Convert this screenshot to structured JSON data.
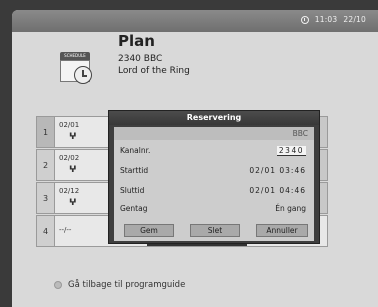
{
  "header": {
    "time": "11:03",
    "date": "22/10"
  },
  "schedule_icon": {
    "label": "SCHEDULE"
  },
  "plan": {
    "title": "Plan",
    "channel": "2340  BBC",
    "program": "Lord of the Ring"
  },
  "list": {
    "rows": [
      {
        "num": "1",
        "date": "02/01"
      },
      {
        "num": "2",
        "date": "02/02"
      },
      {
        "num": "3",
        "date": "02/12"
      },
      {
        "num": "4",
        "date": "--/--"
      }
    ]
  },
  "dialog": {
    "title": "Reservering",
    "channel_name": "BBC",
    "fields": {
      "channel_label": "Kanalnr.",
      "channel_value": "2340",
      "start_label": "Starttid",
      "start_value": "02/01  03:46",
      "end_label": "Sluttid",
      "end_value": "02/01  04:46",
      "repeat_label": "Gentag",
      "repeat_value": "Én gang"
    },
    "buttons": {
      "save": "Gem",
      "delete": "Slet",
      "cancel": "Annuller"
    }
  },
  "footer": {
    "back_label": "Gå tilbage til programguide"
  }
}
